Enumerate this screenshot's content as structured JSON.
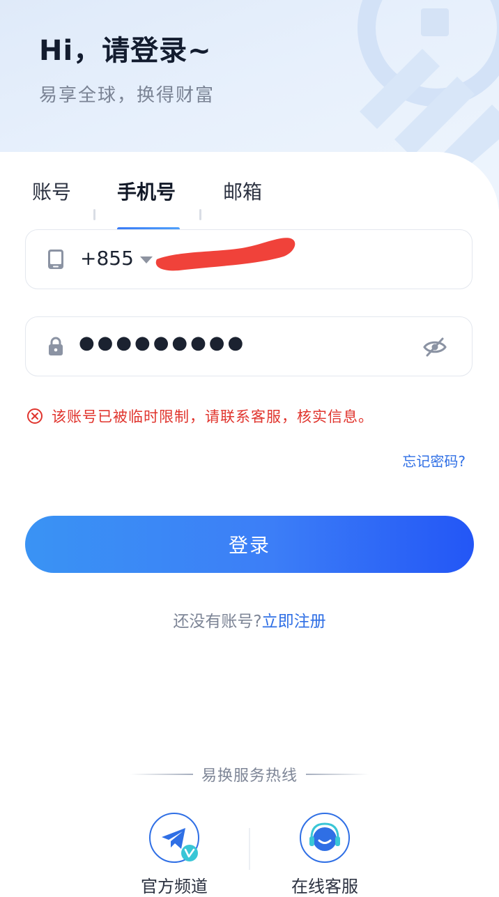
{
  "header": {
    "title": "Hi，请登录~",
    "subtitle": "易享全球，换得财富"
  },
  "tabs": [
    {
      "label": "账号",
      "active": false
    },
    {
      "label": "手机号",
      "active": true
    },
    {
      "label": "邮箱",
      "active": false
    }
  ],
  "phone_field": {
    "icon": "phone-icon",
    "country_code": "+855",
    "number_redacted": true
  },
  "password_field": {
    "icon": "lock-icon",
    "value": "●●●●●●●●●",
    "visibility_icon": "eye-off-icon"
  },
  "error": {
    "icon": "error-circle-icon",
    "message": "该账号已被临时限制，请联系客服，核实信息。"
  },
  "forgot_password": "忘记密码?",
  "login_button": "登录",
  "register": {
    "question": "还没有账号?",
    "link": "立即注册"
  },
  "hotline": {
    "title": "易换服务热线",
    "items": [
      {
        "label": "官方频道",
        "icon": "telegram-icon"
      },
      {
        "label": "在线客服",
        "icon": "headset-icon"
      }
    ]
  },
  "colors": {
    "accent": "#2f6fe5",
    "error": "#e0342d",
    "button_start": "#3a93f4",
    "button_end": "#2356f6"
  }
}
